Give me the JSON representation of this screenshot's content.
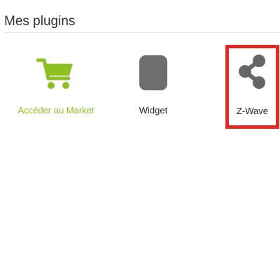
{
  "header": {
    "title": "Mes plugins"
  },
  "plugins": [
    {
      "label": "Accéder au Market",
      "icon": "cart-icon",
      "color": "#8dc022"
    },
    {
      "label": "Widget",
      "icon": "widget-icon",
      "color": "#6e6e6e"
    },
    {
      "label": "Z-Wave",
      "icon": "share-icon",
      "color": "#666666",
      "highlight_color": "#e12a21"
    }
  ]
}
